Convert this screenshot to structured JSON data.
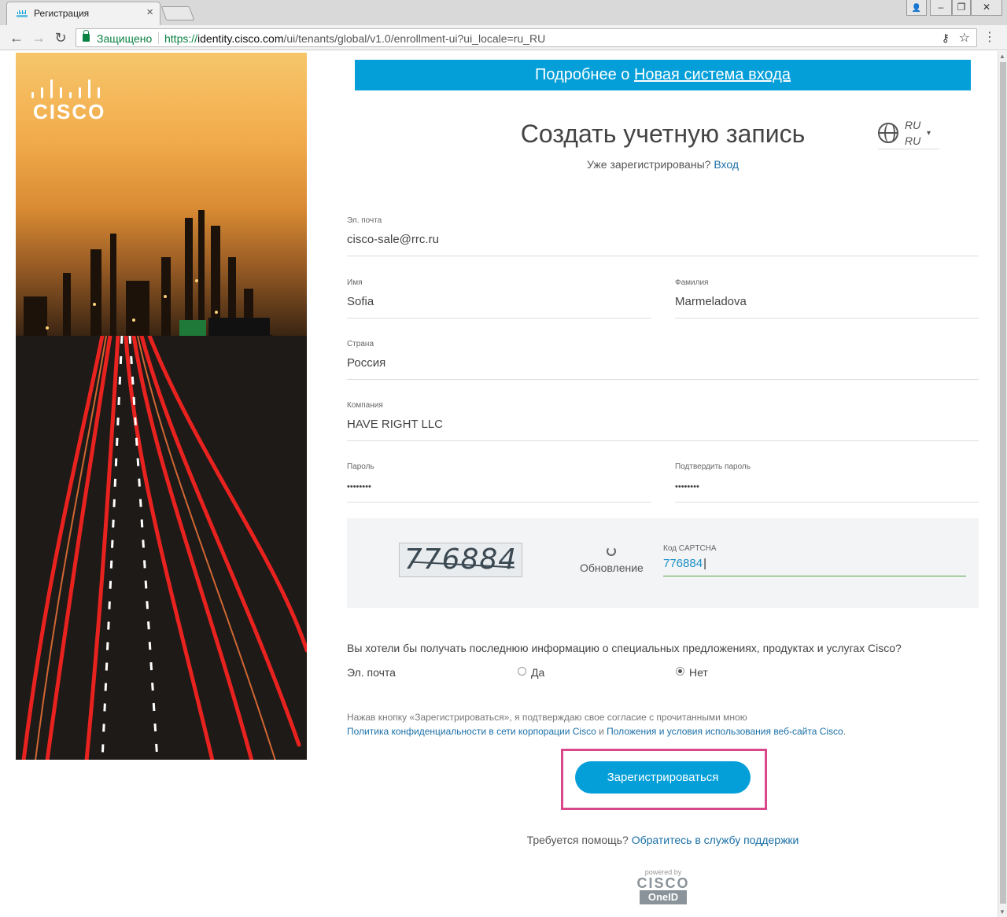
{
  "browser": {
    "tab_title": "Регистрация",
    "tab_close": "×",
    "secure_label": "Защищено",
    "url_scheme": "https://",
    "url_host": "identity.cisco.com",
    "url_path": "/ui/tenants/global/v1.0/enrollment-ui?ui_locale=ru_RU",
    "back": "←",
    "forward": "→",
    "reload": "↻",
    "key": "⚷",
    "star": "☆",
    "menu": "⋮",
    "win_user": "👤",
    "win_min": "–",
    "win_max": "❐",
    "win_close": "✕"
  },
  "hero": {
    "logo_text": "CISCO"
  },
  "banner": {
    "prefix": "Подробнее о ",
    "link": "Новая система входа"
  },
  "header": {
    "title": "Создать учетную запись",
    "already_text": "Уже зарегистрированы? ",
    "login_link": "Вход",
    "lang_1": "RU",
    "lang_2": "RU",
    "lang_caret": "▾"
  },
  "form": {
    "email_label": "Эл. почта",
    "email_value": "cisco-sale@rrc.ru",
    "first_label": "Имя",
    "first_value": "Sofia",
    "last_label": "Фамилия",
    "last_value": "Marmeladova",
    "country_label": "Страна",
    "country_value": "Россия",
    "company_label": "Компания",
    "company_value": "HAVE RIGHT LLC",
    "password_label": "Пароль",
    "password_value": "••••••••",
    "confirm_label": "Подтвердить пароль",
    "confirm_value": "••••••••"
  },
  "captcha": {
    "image_text": "776884",
    "refresh_label": "Обновление",
    "code_label": "Код CAPTCHA",
    "code_value": "776884"
  },
  "marketing": {
    "question": "Вы хотели бы получать последнюю информацию о специальных предложениях, продуктах и услугах Cisco?",
    "channel_label": "Эл. почта",
    "yes_label": "Да",
    "no_label": "Нет",
    "selected": "Нет"
  },
  "consent": {
    "text": "Нажав кнопку «Зарегистрироваться», я подтверждаю свое согласие с прочитанными мною",
    "privacy_link": "Политика конфиденциальности в сети корпорации Cisco",
    "and": " и ",
    "terms_link": "Положения и условия использования веб-сайта Cisco",
    "end": "."
  },
  "submit": {
    "label": "Зарегистрироваться"
  },
  "help": {
    "text": "Требуется помощь? ",
    "link": "Обратитесь в службу поддержки"
  },
  "footer": {
    "powered_by": "powered by",
    "brand": "CISCO",
    "product": "OneID"
  }
}
